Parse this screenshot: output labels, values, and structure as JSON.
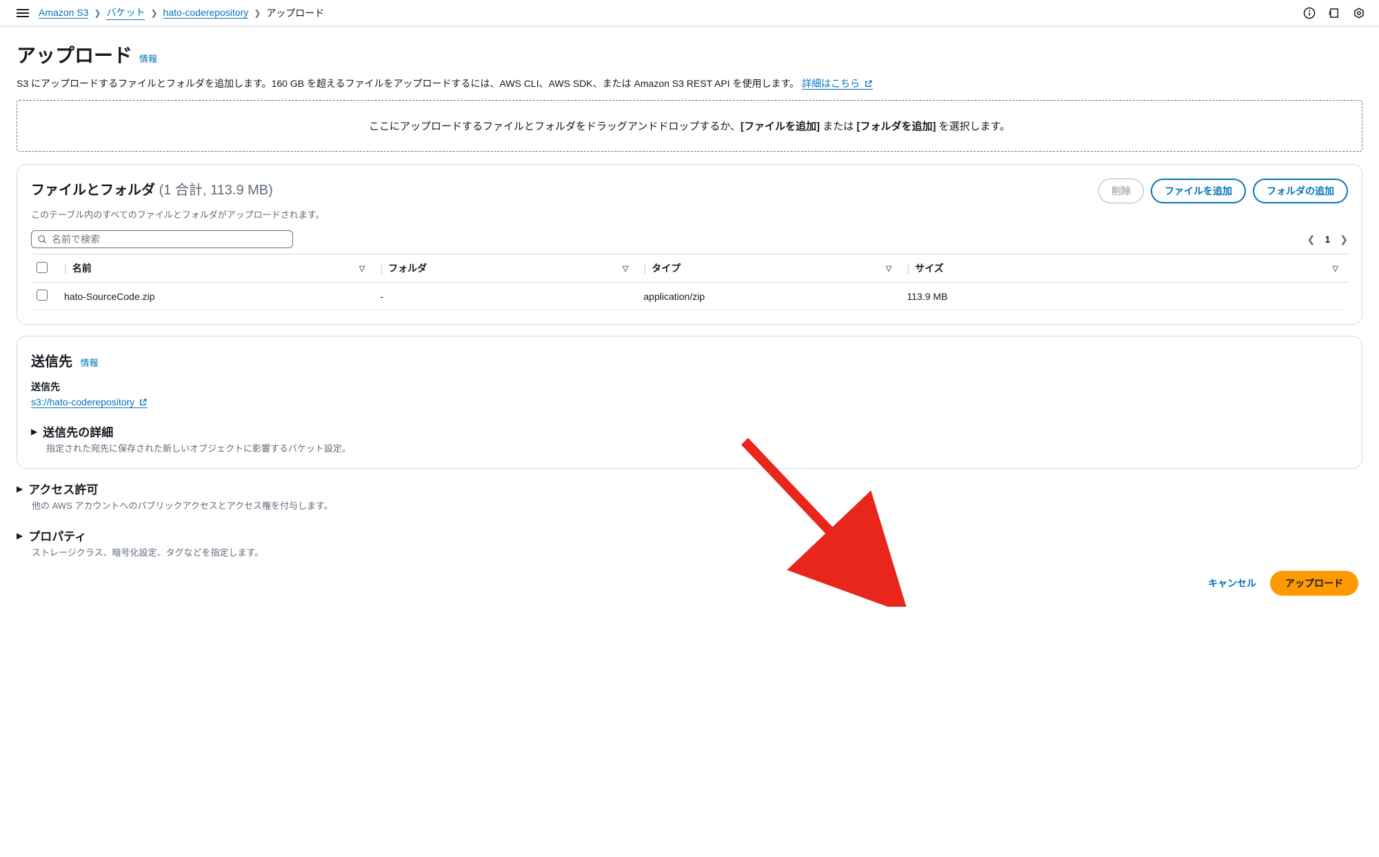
{
  "breadcrumb": {
    "service": "Amazon S3",
    "bucketLabel": "バケット",
    "bucketName": "hato-coderepository",
    "current": "アップロード"
  },
  "page": {
    "title": "アップロード",
    "infoLabel": "情報",
    "descriptionPrefix": "S3 にアップロードするファイルとフォルダを追加します。160 GB を超えるファイルをアップロードするには、AWS CLI、AWS SDK、または Amazon S3 REST API を使用します。",
    "learnMore": "詳細はこちら"
  },
  "dropzone": {
    "prefix": "ここにアップロードするファイルとフォルダをドラッグアンドドロップするか、",
    "addFilesBold": "[ファイルを追加]",
    "middle": " または ",
    "addFolderBold": "[フォルダを追加]",
    "suffix": " を選択します。"
  },
  "filesPanel": {
    "title": "ファイルとフォルダ",
    "count": "(1 合計, 113.9 MB)",
    "subtitle": "このテーブル内のすべてのファイルとフォルダがアップロードされます。",
    "deleteBtn": "削除",
    "addFilesBtn": "ファイルを追加",
    "addFolderBtn": "フォルダの追加",
    "searchPlaceholder": "名前で検索",
    "pageNumber": "1",
    "columns": {
      "name": "名前",
      "folder": "フォルダ",
      "type": "タイプ",
      "size": "サイズ"
    },
    "row": {
      "name": "hato-SourceCode.zip",
      "folder": "-",
      "type": "application/zip",
      "size": "113.9 MB"
    }
  },
  "destination": {
    "panelTitle": "送信先",
    "infoLabel": "情報",
    "label": "送信先",
    "uri": "s3://hato-coderepository",
    "detailsTitle": "送信先の詳細",
    "detailsSub": "指定された宛先に保存された新しいオブジェクトに影響するバケット設定。"
  },
  "permissions": {
    "title": "アクセス許可",
    "sub": "他の AWS アカウントへのパブリックアクセスとアクセス権を付与します。"
  },
  "properties": {
    "title": "プロパティ",
    "sub": "ストレージクラス、暗号化設定、タグなどを指定します。"
  },
  "footer": {
    "cancel": "キャンセル",
    "upload": "アップロード"
  }
}
